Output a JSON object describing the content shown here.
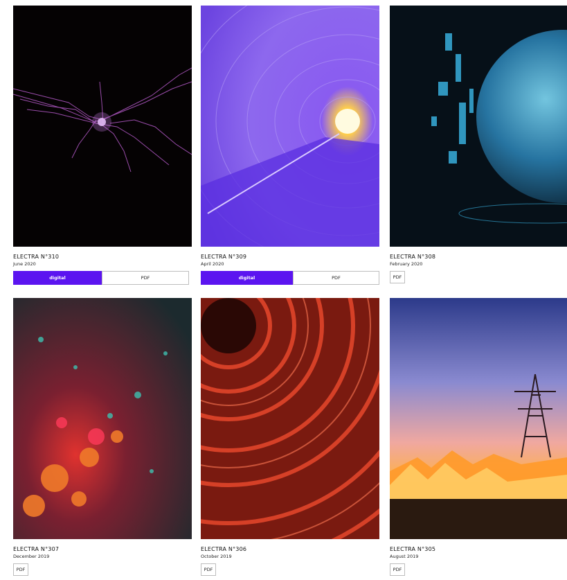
{
  "issues": [
    {
      "title": "ELECTRA N°310",
      "date": "June 2020",
      "digital_label": "digital",
      "pdf_label": "PDF",
      "has_digital": true,
      "colors": {
        "bg": "#050203",
        "accent": "#b45ac8"
      }
    },
    {
      "title": "ELECTRA N°309",
      "date": "April 2020",
      "digital_label": "digital",
      "pdf_label": "PDF",
      "has_digital": true,
      "colors": {
        "bg": "#7a4fe6",
        "accent": "#ffcf4a"
      }
    },
    {
      "title": "ELECTRA N°308",
      "date": "February 2020",
      "pdf_label": "PDF",
      "has_digital": false,
      "colors": {
        "bg": "#061018",
        "accent": "#3bb8e8"
      }
    },
    {
      "title": "ELECTRA N°307",
      "date": "December 2019",
      "pdf_label": "PDF",
      "has_digital": false,
      "colors": {
        "bg": "#1c2a2e",
        "accent": "#e0322f"
      }
    },
    {
      "title": "ELECTRA N°306",
      "date": "October 2019",
      "pdf_label": "PDF",
      "has_digital": false,
      "colors": {
        "bg": "#7a1a10",
        "accent": "#e0452a"
      }
    },
    {
      "title": "ELECTRA N°305",
      "date": "August 2019",
      "pdf_label": "PDF",
      "has_digital": false,
      "colors": {
        "bg": "#2c3a8a",
        "accent": "#ffb23a"
      }
    }
  ],
  "brand_color": "#5b14f0"
}
